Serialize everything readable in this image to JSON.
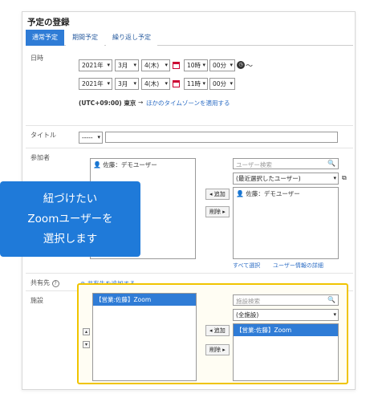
{
  "page_title": "予定の登録",
  "tabs": [
    "通常予定",
    "期間予定",
    "繰り返し予定"
  ],
  "datetime": {
    "label": "日時",
    "start": {
      "year": "2021年",
      "month": "3月",
      "day": "4(木)",
      "hour": "10時",
      "minute": "00分"
    },
    "end": {
      "year": "2021年",
      "month": "3月",
      "day": "4(木)",
      "hour": "11時",
      "minute": "00分"
    },
    "tilde": "〜",
    "timezone": "(UTC+09:00) 東京",
    "timezone_arrow": "→",
    "timezone_link": "ほかのタイムゾーンを適用する"
  },
  "title_row": {
    "label": "タイトル",
    "select": "-----"
  },
  "attendees": {
    "label": "参加者",
    "selected": [
      "佐藤：デモユーザー"
    ],
    "add_button": "◂ 追加",
    "remove_button": "削除 ▸",
    "search_placeholder": "ユーザー検索",
    "filter": "(最近選択したユーザー)",
    "candidates": [
      "佐藤：デモユーザー"
    ],
    "select_all": "すべて選択",
    "detail_link": "ユーザー情報の詳細"
  },
  "share": {
    "label": "共有先",
    "help_icon": "?",
    "add_link": "共有先を追加する"
  },
  "facility": {
    "label": "施設",
    "selected": [
      "【営業:佐藤】Zoom"
    ],
    "add_button": "◂ 追加",
    "remove_button": "削除 ▸",
    "search_placeholder": "施設検索",
    "filter": "(全施設)",
    "candidates": [
      "【営業:佐藤】Zoom"
    ]
  },
  "callout": {
    "line1": "紐づけたい",
    "line2": "Zoomユーザーを",
    "line3": "選択します"
  },
  "colors": {
    "accent": "#2f7cd6",
    "highlight": "#f0c400",
    "callout": "#1f7ad9"
  }
}
